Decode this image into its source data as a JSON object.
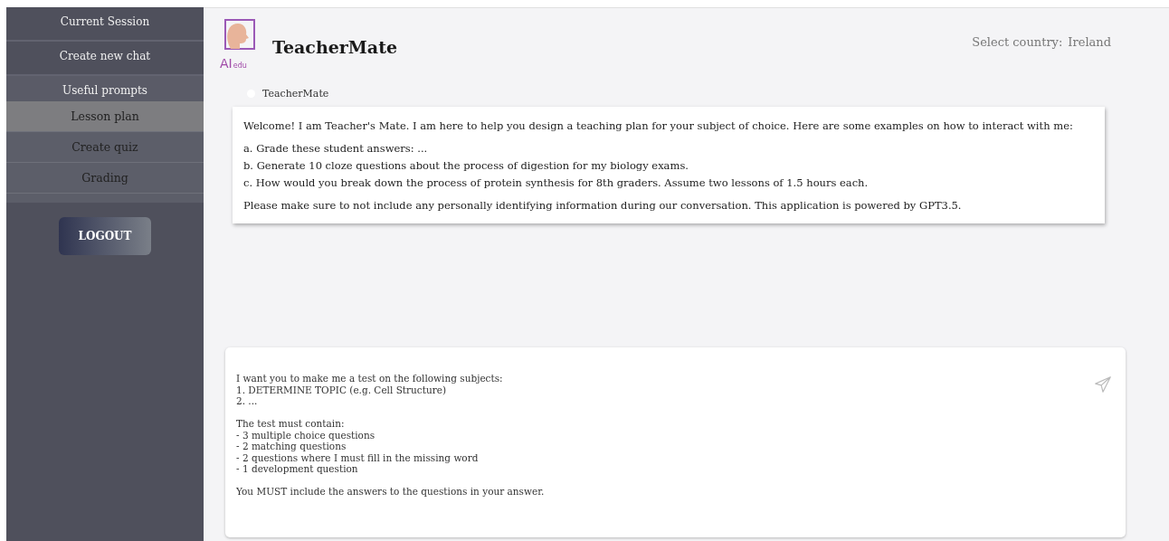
{
  "sidebar": {
    "nav": [
      {
        "label": "Current Session"
      },
      {
        "label": "Create new chat"
      }
    ],
    "prompts_heading": "Useful prompts",
    "prompts": [
      {
        "label": "Lesson plan",
        "selected": true
      },
      {
        "label": "Create quiz",
        "selected": false
      },
      {
        "label": "Grading",
        "selected": false
      }
    ],
    "logout": "LOGOUT"
  },
  "header": {
    "logo": {
      "initials": "AI",
      "suffix": "edu"
    },
    "title": "TeacherMate",
    "country_label": "Select country:",
    "country": "Ireland"
  },
  "chat": {
    "sender": "TeacherMate",
    "message": {
      "intro": "Welcome! I am Teacher's Mate. I am here to help you design a teaching plan for your subject of choice. Here are some examples on how to interact with me:",
      "examples": [
        "a. Grade these student answers: ...",
        "b. Generate 10 cloze questions about the process of digestion for my biology exams.",
        "c. How would you break down the process of protein synthesis for 8th graders. Assume two lessons of 1.5 hours each."
      ],
      "note": "Please make sure to not include any personally identifying information during our conversation. This application is powered by GPT3.5."
    }
  },
  "input": {
    "value": "I want you to make me a test on the following subjects:\n1. DETERMINE TOPIC (e.g. Cell Structure)\n2. ...\n\nThe test must contain:\n- 3 multiple choice questions\n- 2 matching questions\n- 2 questions where I must fill in the missing word\n- 1 development question\n\nYou MUST include the answers to the questions in your answer."
  }
}
